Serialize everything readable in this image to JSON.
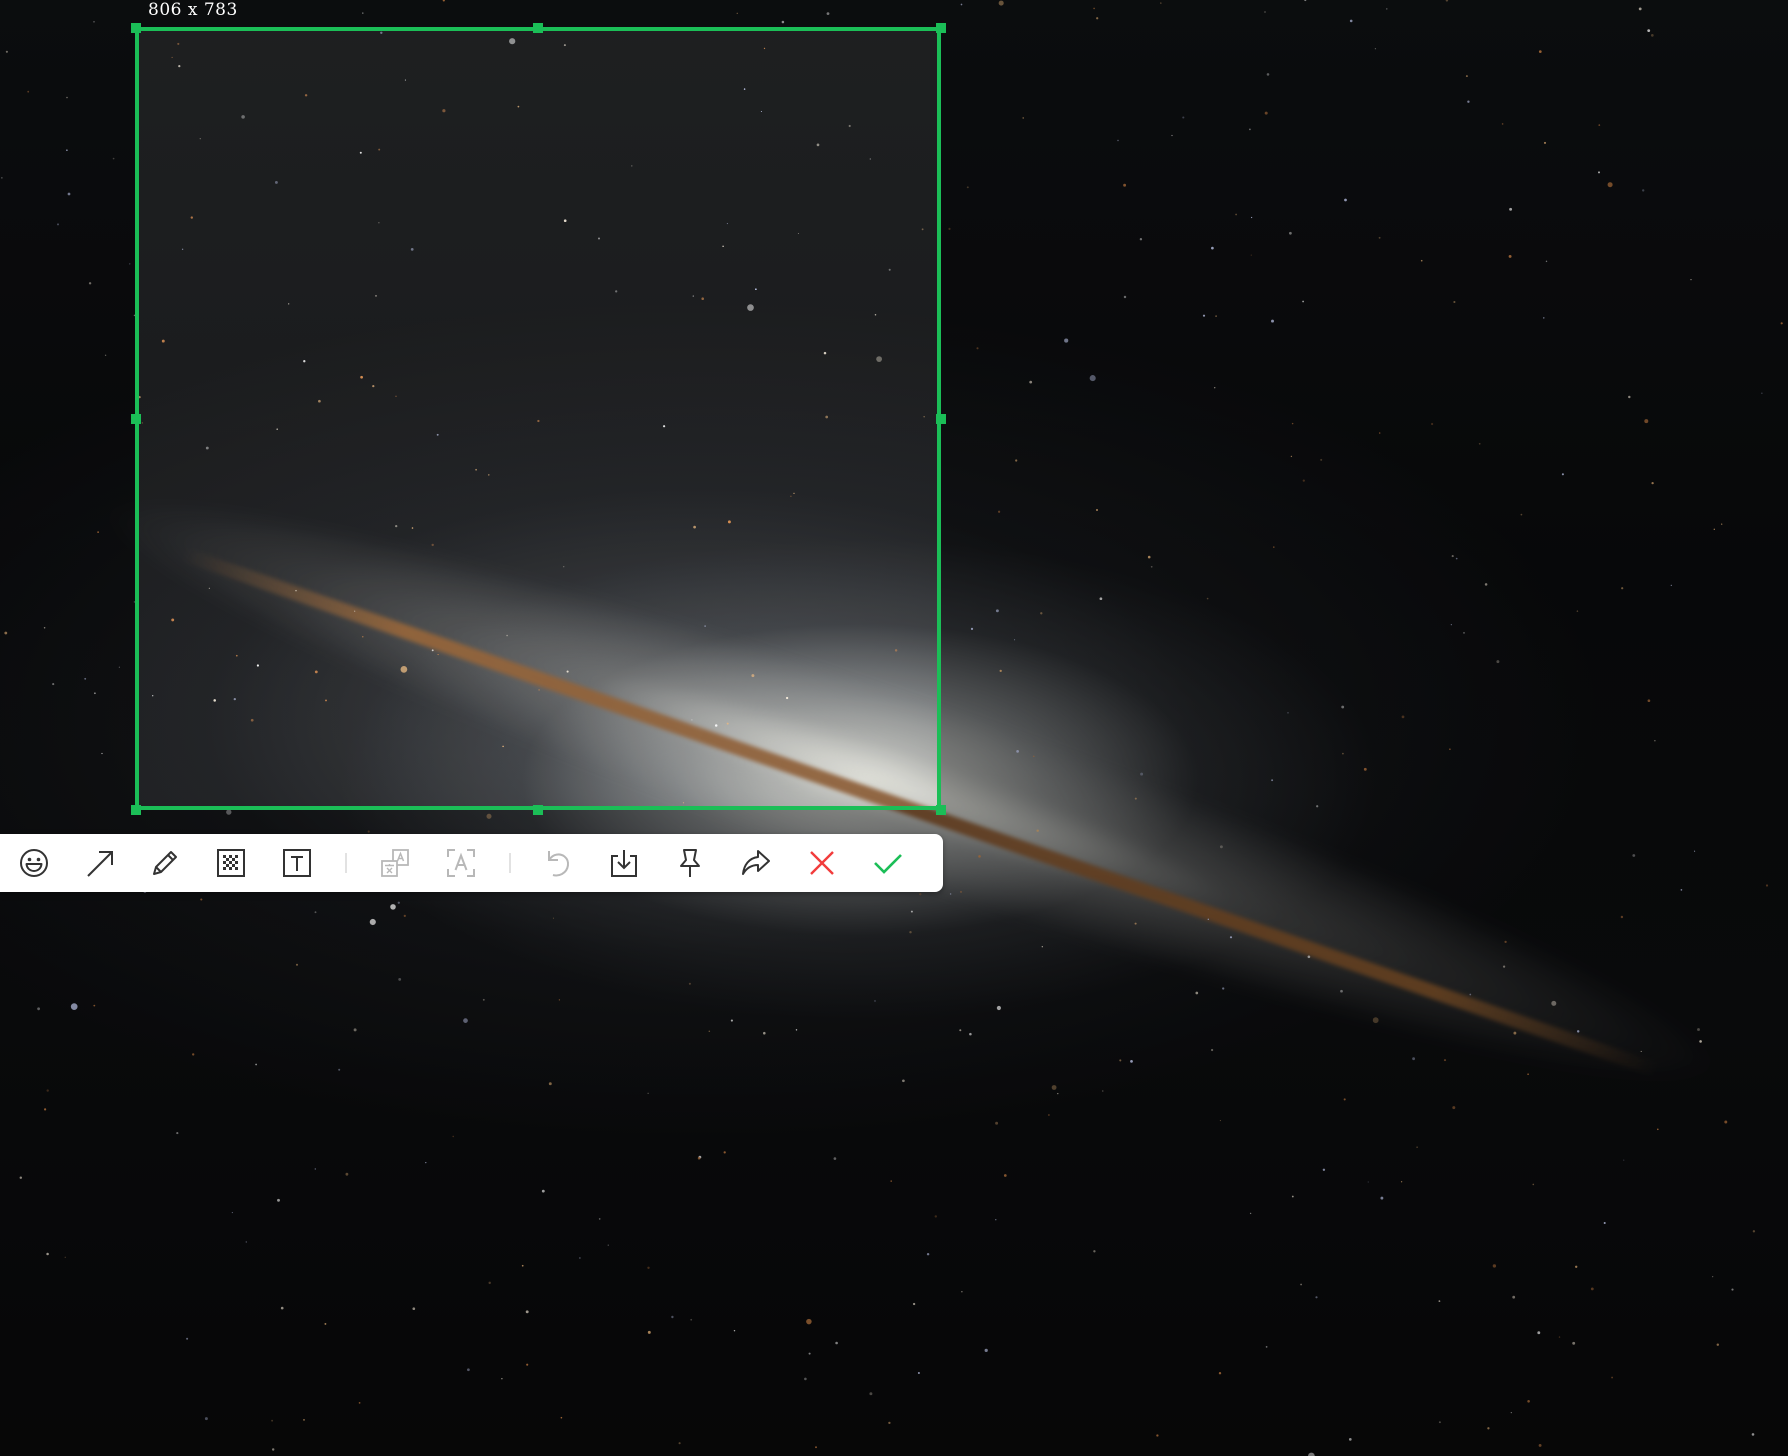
{
  "selection": {
    "size_label": "806 x 783",
    "accent_color": "#1bbe57"
  },
  "toolbar": {
    "tools": [
      {
        "name": "emoji",
        "icon": "emoji-icon",
        "enabled": true
      },
      {
        "name": "arrow",
        "icon": "arrow-icon",
        "enabled": true
      },
      {
        "name": "pencil",
        "icon": "pencil-icon",
        "enabled": true
      },
      {
        "name": "mosaic",
        "icon": "mosaic-icon",
        "enabled": true
      },
      {
        "name": "text",
        "icon": "text-icon",
        "enabled": true
      },
      {
        "name": "translate",
        "icon": "translate-icon",
        "enabled": false
      },
      {
        "name": "ocr",
        "icon": "ocr-icon",
        "enabled": false
      },
      {
        "name": "undo",
        "icon": "undo-icon",
        "enabled": false
      },
      {
        "name": "save",
        "icon": "download-icon",
        "enabled": true
      },
      {
        "name": "pin",
        "icon": "pin-icon",
        "enabled": true
      },
      {
        "name": "share",
        "icon": "share-icon",
        "enabled": true
      },
      {
        "name": "cancel",
        "icon": "close-icon",
        "enabled": true
      },
      {
        "name": "confirm",
        "icon": "check-icon",
        "enabled": true
      }
    ],
    "colors": {
      "icon": "#333333",
      "disabled": "#b8b8b8",
      "cancel": "#f23c3c",
      "confirm": "#1bbe57"
    }
  }
}
